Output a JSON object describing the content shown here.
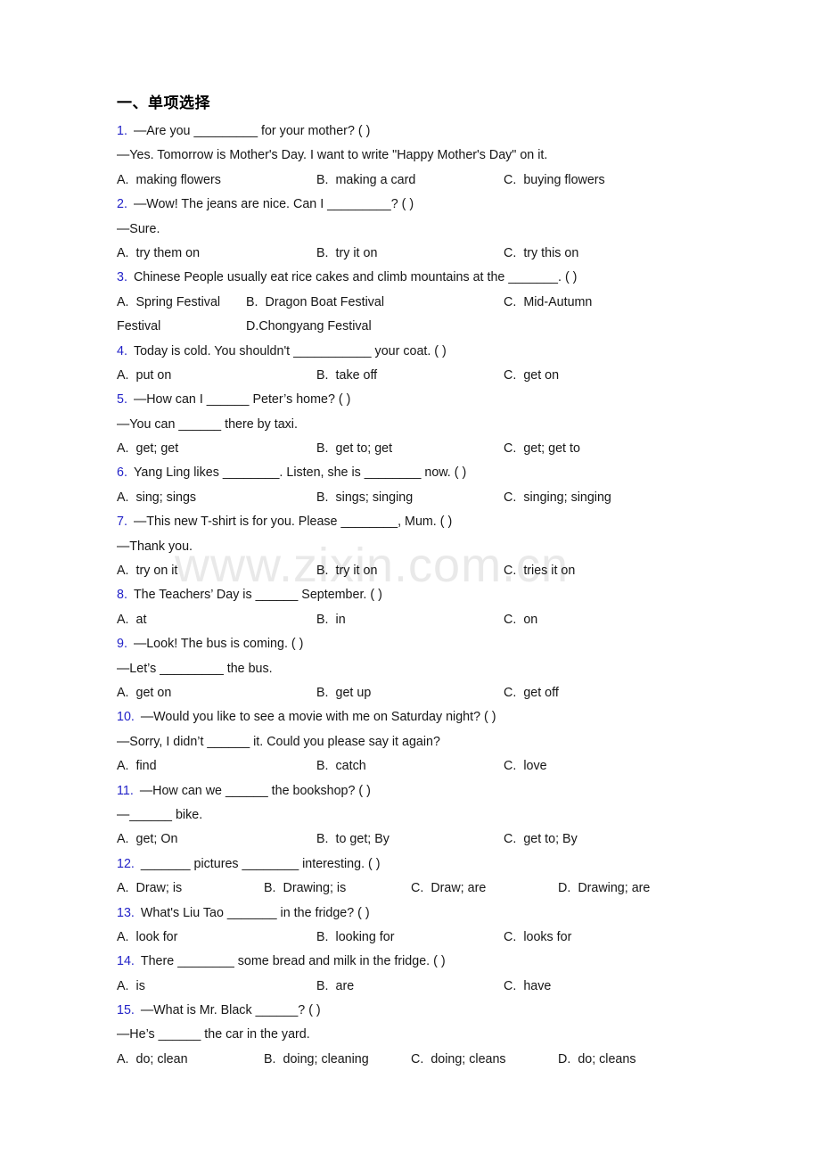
{
  "document": {
    "section_title": "一、单项选择",
    "watermark": "www.zixin.com.cn"
  },
  "questions": [
    {
      "num": "1.",
      "stem": "—Are you _________ for your mother? (   )",
      "cont": "—Yes. Tomorrow is Mother's Day. I want to write \"Happy Mother's Day\" on it.",
      "cols": 3,
      "options": [
        {
          "label": "A.",
          "text": "making flowers"
        },
        {
          "label": "B.",
          "text": "making a card"
        },
        {
          "label": "C.",
          "text": "buying flowers"
        }
      ]
    },
    {
      "num": "2.",
      "stem": "—Wow! The jeans are nice. Can I _________? (   )",
      "cont": "—Sure.",
      "cols": 3,
      "options": [
        {
          "label": "A.",
          "text": "try them on"
        },
        {
          "label": "B.",
          "text": "try it on"
        },
        {
          "label": "C.",
          "text": "try this on"
        }
      ]
    },
    {
      "num": "3.",
      "stem": "Chinese People usually eat rice cakes and climb mountains at the _______. (  )",
      "cont": "",
      "cols": 3,
      "wrapped": true,
      "options": [
        {
          "label": "A.",
          "text": "Spring Festival"
        },
        {
          "label": "B.",
          "text": "Dragon Boat Festival"
        },
        {
          "label": "C.",
          "text": "Mid-Autumn"
        }
      ],
      "wrap_row": [
        {
          "label": "",
          "text": "Festival"
        },
        {
          "label": "D.",
          "text": "Chongyang Festival"
        }
      ]
    },
    {
      "num": "4.",
      "stem": "Today is cold. You shouldn't ___________ your coat. (  )",
      "cont": "",
      "cols": 3,
      "options": [
        {
          "label": "A.",
          "text": "put on"
        },
        {
          "label": "B.",
          "text": "take off"
        },
        {
          "label": "C.",
          "text": "get on"
        }
      ]
    },
    {
      "num": "5.",
      "stem": "—How can I ______ Peter’s home? (  )",
      "cont": "—You can ______ there by taxi.",
      "cols": 3,
      "options": [
        {
          "label": "A.",
          "text": "get; get"
        },
        {
          "label": "B.",
          "text": "get to; get"
        },
        {
          "label": "C.",
          "text": "get; get to"
        }
      ]
    },
    {
      "num": "6.",
      "stem": "Yang Ling likes ________. Listen, she is ________ now. (   )",
      "cont": "",
      "cols": 3,
      "options": [
        {
          "label": "A.",
          "text": "sing; sings"
        },
        {
          "label": "B.",
          "text": "sings; singing"
        },
        {
          "label": "C.",
          "text": "singing; singing"
        }
      ]
    },
    {
      "num": "7.",
      "stem": "—This new T-shirt is for you. Please ________, Mum. (    )",
      "cont": "—Thank you.",
      "cols": 3,
      "options": [
        {
          "label": "A.",
          "text": "try on it"
        },
        {
          "label": "B.",
          "text": "try it on"
        },
        {
          "label": "C.",
          "text": "tries it on"
        }
      ]
    },
    {
      "num": "8.",
      "stem": "The Teachers’ Day is ______ September. (  )",
      "cont": "",
      "cols": 3,
      "options": [
        {
          "label": "A.",
          "text": "at"
        },
        {
          "label": "B.",
          "text": "in"
        },
        {
          "label": "C.",
          "text": "on"
        }
      ]
    },
    {
      "num": "9.",
      "stem": "—Look! The bus is coming. (  )",
      "cont": "—Let’s _________ the bus.",
      "cols": 3,
      "options": [
        {
          "label": "A.",
          "text": "get on"
        },
        {
          "label": "B.",
          "text": "get up"
        },
        {
          "label": "C.",
          "text": "get off"
        }
      ]
    },
    {
      "num": "10.",
      "stem": "—Would you like to see a movie with me on Saturday night? (  )",
      "cont": "—Sorry, I didn’t ______ it. Could you please say it again?",
      "cols": 3,
      "options": [
        {
          "label": "A.",
          "text": "find"
        },
        {
          "label": "B.",
          "text": "catch"
        },
        {
          "label": "C.",
          "text": "love"
        }
      ]
    },
    {
      "num": "11.",
      "stem": "—How can we ______ the bookshop? (  )",
      "cont": "—______ bike.",
      "cols": 3,
      "options": [
        {
          "label": "A.",
          "text": "get; On"
        },
        {
          "label": "B.",
          "text": "to get; By"
        },
        {
          "label": "C.",
          "text": "get to; By"
        }
      ]
    },
    {
      "num": "12.",
      "stem": "_______ pictures ________ interesting. (  )",
      "cont": "",
      "cols": 4,
      "options": [
        {
          "label": "A.",
          "text": "Draw; is"
        },
        {
          "label": "B.",
          "text": "Drawing; is"
        },
        {
          "label": "C.",
          "text": "Draw; are"
        },
        {
          "label": "D.",
          "text": "Drawing; are"
        }
      ]
    },
    {
      "num": "13.",
      "stem": "What's Liu Tao _______ in the fridge? (  )",
      "cont": "",
      "cols": 3,
      "options": [
        {
          "label": "A.",
          "text": "look for"
        },
        {
          "label": "B.",
          "text": "looking for"
        },
        {
          "label": "C.",
          "text": "looks for"
        }
      ]
    },
    {
      "num": "14.",
      "stem": "There ________ some bread and milk in the fridge. (  )",
      "cont": "",
      "cols": 3,
      "options": [
        {
          "label": "A.",
          "text": "is"
        },
        {
          "label": "B.",
          "text": "are"
        },
        {
          "label": "C.",
          "text": "have"
        }
      ]
    },
    {
      "num": "15.",
      "stem": "—What is Mr. Black ______? (   )",
      "cont": "—He’s ______ the car in the yard.",
      "cols": 4,
      "options": [
        {
          "label": "A.",
          "text": "do; clean"
        },
        {
          "label": "B.",
          "text": "doing; cleaning"
        },
        {
          "label": "C.",
          "text": "doing; cleans"
        },
        {
          "label": "D.",
          "text": "do; cleans"
        }
      ]
    }
  ]
}
